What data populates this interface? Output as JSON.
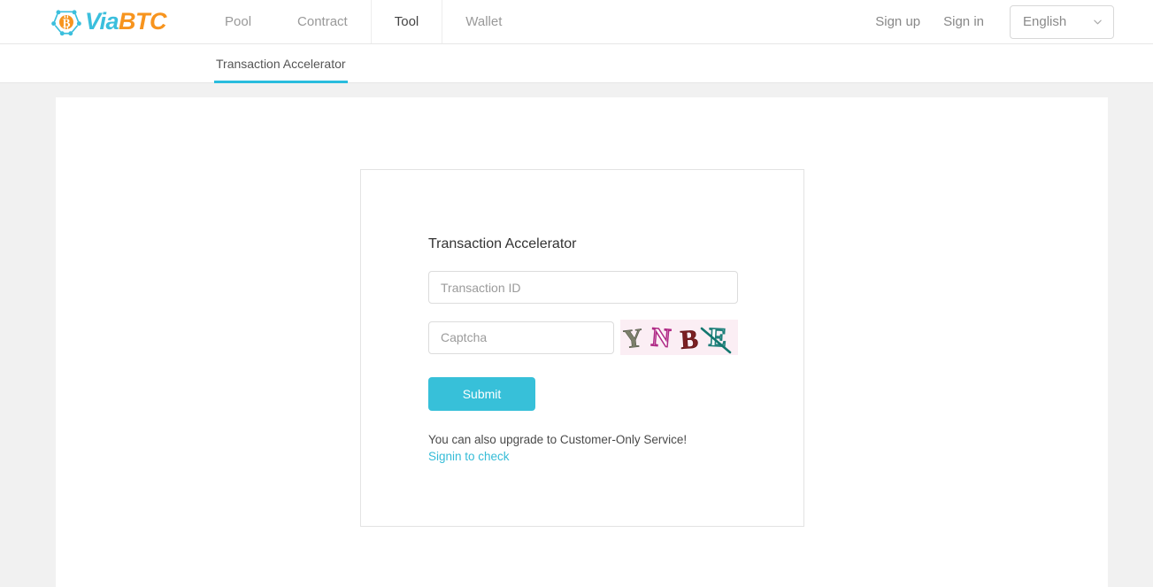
{
  "brand": {
    "name_part1": "Via",
    "name_part2": "BTC",
    "icon": "viabtc-bitcoin-node-logo"
  },
  "header": {
    "nav": [
      {
        "label": "Pool",
        "active": false
      },
      {
        "label": "Contract",
        "active": false
      },
      {
        "label": "Tool",
        "active": true
      },
      {
        "label": "Wallet",
        "active": false
      }
    ],
    "sign_up": "Sign up",
    "sign_in": "Sign in",
    "language": {
      "selected": "English",
      "options": [
        "English"
      ],
      "chevron_icon": "chevron-down-icon"
    }
  },
  "subnav": {
    "tabs": [
      {
        "label": "Transaction Accelerator",
        "active": true
      }
    ]
  },
  "form": {
    "title": "Transaction Accelerator",
    "txid_placeholder": "Transaction ID",
    "txid_value": "",
    "captcha_placeholder": "Captcha",
    "captcha_value": "",
    "captcha_image": {
      "name": "captcha-image",
      "text": "YNBE",
      "letters": [
        {
          "char": "Y",
          "color": "#7c7f6b"
        },
        {
          "char": "N",
          "color": "#b02a86"
        },
        {
          "char": "B",
          "color": "#7b1f22"
        },
        {
          "char": "E",
          "color": "#1e7f7a"
        }
      ],
      "background": "#fbeef4",
      "stroke_color": "#12776f"
    },
    "submit_label": "Submit",
    "note_text": "You can also upgrade to Customer-Only Service!",
    "note_link_text": "Signin to check"
  },
  "colors": {
    "accent_teal": "#37c0d9",
    "tab_underline": "#29bcdd",
    "brand_cyan": "#3bbfdd",
    "brand_orange": "#f7941e",
    "page_background": "#f1f1f1",
    "panel_background": "#ffffff"
  }
}
